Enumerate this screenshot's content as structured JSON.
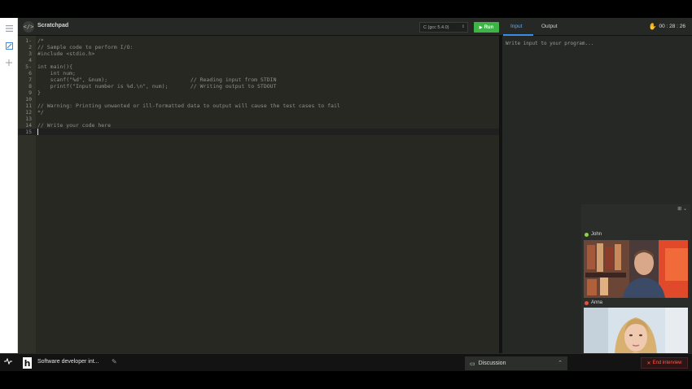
{
  "sidebar": {
    "menu_icon": "menu-icon",
    "edit_icon": "edit-icon",
    "add_icon": "add-icon"
  },
  "topbar": {
    "title": "Scratchpad",
    "language": "C (gcc 5.4.0)",
    "run_label": "Run",
    "tabs": [
      {
        "label": "Input",
        "active": true
      },
      {
        "label": "Output",
        "active": false
      }
    ],
    "timer": "00 : 28 : 26"
  },
  "editor": {
    "lines": [
      {
        "n": "1-",
        "text": "/*"
      },
      {
        "n": "2",
        "text": "// Sample code to perform I/O:"
      },
      {
        "n": "3",
        "text": "#include <stdio.h>"
      },
      {
        "n": "4",
        "text": ""
      },
      {
        "n": "5-",
        "text": "int main(){"
      },
      {
        "n": "6",
        "text": "    int num;"
      },
      {
        "n": "7",
        "text": "    scanf(\"%d\", &num);                          // Reading input from STDIN"
      },
      {
        "n": "8",
        "text": "    printf(\"Input number is %d.\\n\", num);       // Writing output to STDOUT"
      },
      {
        "n": "9",
        "text": "}"
      },
      {
        "n": "10",
        "text": ""
      },
      {
        "n": "11",
        "text": "// Warning: Printing unwanted or ill-formatted data to output will cause the test cases to fail"
      },
      {
        "n": "12",
        "text": "*/"
      },
      {
        "n": "13",
        "text": ""
      },
      {
        "n": "14",
        "text": "// Write your code here"
      },
      {
        "n": "15",
        "text": ""
      }
    ]
  },
  "io": {
    "input_placeholder": "Write input to your program..."
  },
  "video": {
    "participants": [
      {
        "name": "John",
        "status_color": "#8fd14f"
      },
      {
        "name": "Anna",
        "status_color": "#e0503c"
      }
    ]
  },
  "bottombar": {
    "interview_name": "Software developer int...",
    "discussion_label": "Discussion",
    "end_label": "End interview"
  }
}
